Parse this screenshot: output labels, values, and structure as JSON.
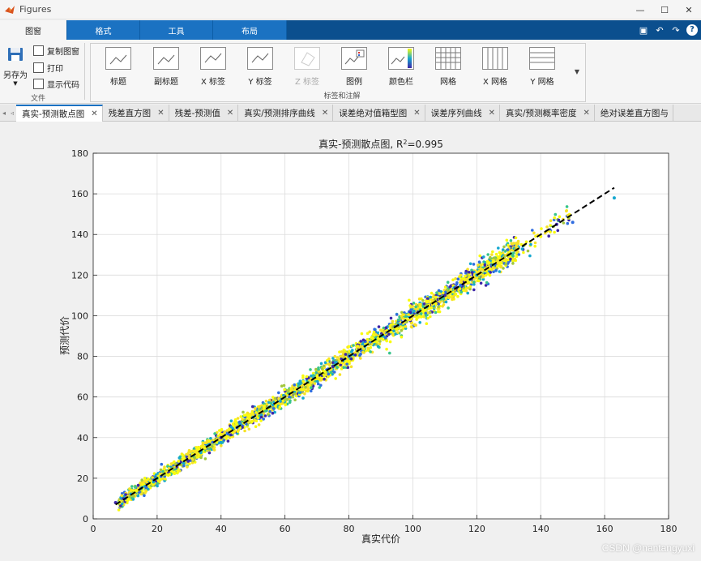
{
  "window": {
    "title": "Figures"
  },
  "ribbon_tabs": [
    "图窗",
    "格式",
    "工具",
    "布局"
  ],
  "file_group": {
    "save_as": "另存为",
    "copy_figure": "复制图窗",
    "print": "打印",
    "show_code": "显示代码",
    "label": "文件"
  },
  "labels_group": {
    "label": "标签和注解",
    "buttons": [
      "标题",
      "副标题",
      "X 标签",
      "Y 标签",
      "Z 标签",
      "图例",
      "颜色栏",
      "网格",
      "X 网格",
      "Y 网格"
    ]
  },
  "figure_tabs": [
    "真实-预测散点图",
    "残差直方图",
    "残差-预测值",
    "真实/预测排序曲线",
    "误差绝对值箱型图",
    "误差序列曲线",
    "真实/预测概率密度",
    "绝对误差直方图与"
  ],
  "chart_data": {
    "type": "scatter",
    "title": "真实-预测散点图, R²=0.995",
    "xlabel": "真实代价",
    "ylabel": "预测代价",
    "xlim": [
      0,
      180
    ],
    "ylim": [
      0,
      180
    ],
    "xticks": [
      0,
      20,
      40,
      60,
      80,
      100,
      120,
      140,
      160,
      180
    ],
    "yticks": [
      0,
      20,
      40,
      60,
      80,
      100,
      120,
      140,
      160,
      180
    ],
    "grid": true,
    "colormap": [
      "#3e26a8",
      "#2e6ce0",
      "#15a7cf",
      "#38c48a",
      "#a2c73f",
      "#f6e227",
      "#f9fb0e"
    ],
    "reference_line": {
      "x": [
        7,
        163
      ],
      "y": [
        7,
        163
      ],
      "style": "dashed",
      "color": "#000000"
    },
    "series": [
      {
        "x": [
          7,
          10,
          15,
          20,
          25,
          30,
          35,
          40,
          45,
          50,
          55,
          60,
          65,
          70,
          75,
          80,
          85,
          90,
          95,
          100,
          105,
          110,
          115,
          120,
          125,
          130,
          135,
          140,
          145,
          150,
          163
        ],
        "y": [
          8,
          10,
          15,
          20,
          25,
          30,
          35,
          40,
          45,
          50,
          55,
          60,
          65,
          70,
          75,
          80,
          85,
          90,
          95,
          100,
          105,
          110,
          115,
          120,
          125,
          130,
          135,
          139,
          145,
          146,
          158
        ]
      }
    ]
  },
  "watermark": "CSDN @nantangyuxi"
}
